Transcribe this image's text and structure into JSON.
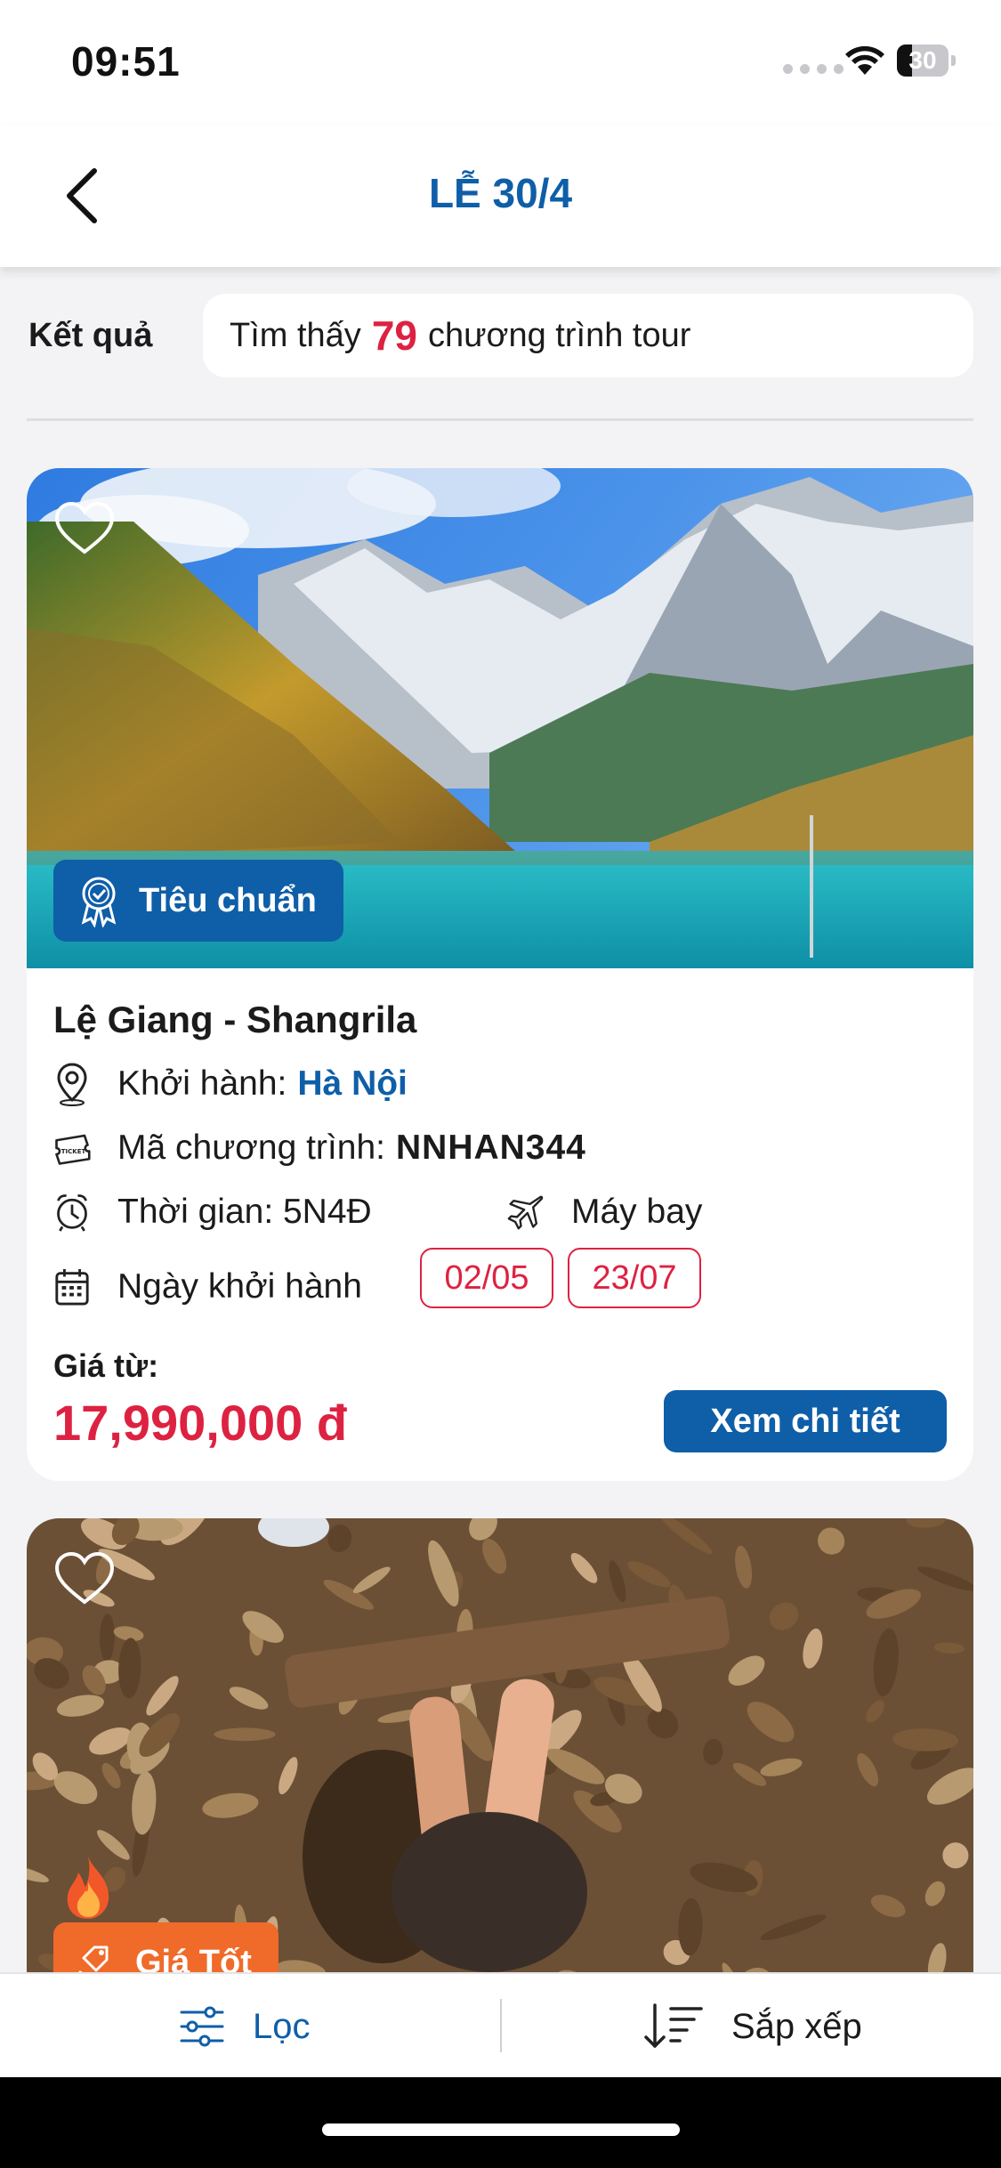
{
  "status_bar": {
    "time": "09:51",
    "battery_level": "30",
    "battery_fraction": 0.3
  },
  "header": {
    "title": "LỄ 30/4",
    "back_icon": "chevron-left-icon"
  },
  "results": {
    "label": "Kết quả",
    "prefix": "Tìm thấy",
    "count": "79",
    "suffix": "chương trình tour"
  },
  "tours": [
    {
      "badge": "Tiêu chuẩn",
      "title": "Lệ Giang - Shangrila",
      "depart_label": "Khởi hành:",
      "depart_value": "Hà Nội",
      "code_label": "Mã chương trình:",
      "code_value": "NNHAN344",
      "duration_label": "Thời gian: 5N4Đ",
      "transport": "Máy bay",
      "dates_label": "Ngày khởi hành",
      "dates": [
        "02/05",
        "23/07"
      ],
      "price_label": "Giá từ:",
      "price": "17,990,000 đ",
      "detail_button": "Xem chi tiết"
    },
    {
      "badge": "Giá Tốt"
    }
  ],
  "bottom_bar": {
    "filter_label": "Lọc",
    "sort_label": "Sắp xếp"
  },
  "colors": {
    "brand_blue": "#0f5ea8",
    "accent_red": "#dd2241",
    "hot_orange": "#f06a2a",
    "background": "#f3f3f5"
  }
}
